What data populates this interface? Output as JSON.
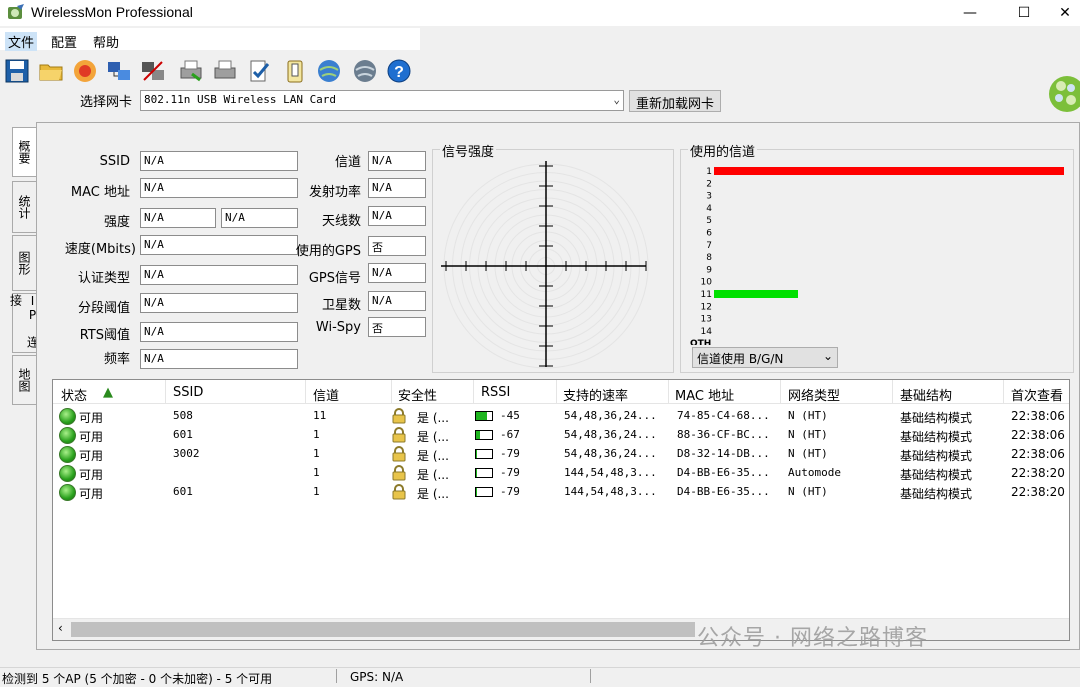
{
  "window": {
    "title": "WirelessMon Professional",
    "controls": {
      "minimize": "—",
      "maximize": "☐",
      "close": "✕"
    }
  },
  "menu": {
    "items": [
      "文件",
      "配置",
      "帮助"
    ]
  },
  "toolbar": {
    "icons": [
      "save-icon",
      "open-folder-icon",
      "record-icon",
      "network-adapter-icon",
      "network-adapter-off-icon",
      "print-icon",
      "print-preview-icon",
      "checklist-icon",
      "clipboard-icon",
      "globe-back-icon",
      "globe-forward-icon",
      "help-icon"
    ]
  },
  "nic": {
    "label": "选择网卡",
    "selected": "802.11n USB Wireless LAN Card",
    "reload_label": "重新加载网卡"
  },
  "tabs": [
    "概要",
    "统计",
    "图形",
    "IP 连接",
    "地图"
  ],
  "summary": {
    "left_fields": [
      {
        "label": "SSID",
        "value": "N/A"
      },
      {
        "label": "MAC 地址",
        "value": "N/A"
      },
      {
        "label": "强度",
        "value": "N/A",
        "value2": "N/A"
      },
      {
        "label": "速度(Mbits)",
        "value": "N/A"
      },
      {
        "label": "认证类型",
        "value": "N/A"
      },
      {
        "label": "分段阈值",
        "value": "N/A"
      },
      {
        "label": "RTS阈值",
        "value": "N/A"
      },
      {
        "label": "频率",
        "value": "N/A"
      }
    ],
    "right_fields": [
      {
        "label": "信道",
        "value": "N/A"
      },
      {
        "label": "发射功率",
        "value": "N/A"
      },
      {
        "label": "天线数",
        "value": "N/A"
      },
      {
        "label": "使用的GPS",
        "value": "否"
      },
      {
        "label": "GPS信号",
        "value": "N/A"
      },
      {
        "label": "卫星数",
        "value": "N/A"
      },
      {
        "label": "Wi-Spy",
        "value": "否"
      }
    ]
  },
  "signal_group": {
    "title": "信号强度"
  },
  "channel_group": {
    "title": "使用的信道",
    "channel_labels": [
      "1",
      "2",
      "3",
      "4",
      "5",
      "6",
      "7",
      "8",
      "9",
      "10",
      "11",
      "12",
      "13",
      "14",
      "OTH"
    ],
    "usage": [
      {
        "channel": "1",
        "fraction": 1.0,
        "color": "#ff0000"
      },
      {
        "channel": "11",
        "fraction": 0.24,
        "color": "#00e000"
      }
    ],
    "mode_select": "信道使用 B/G/N"
  },
  "ap_list": {
    "columns": [
      "状态",
      "SSID",
      "信道",
      "安全性",
      "RSSI",
      "支持的速率",
      "MAC 地址",
      "网络类型",
      "基础结构",
      "首次查看"
    ],
    "rows": [
      {
        "status": "可用",
        "ssid": "508",
        "channel": "11",
        "security": "是 (...",
        "signal": 0.7,
        "rssi": "-45",
        "rates": "54,48,36,24...",
        "mac": "74-85-C4-68...",
        "net_type": "N (HT)",
        "infra": "基础结构模式",
        "first_seen": "22:38:06"
      },
      {
        "status": "可用",
        "ssid": "601",
        "channel": "1",
        "security": "是 (...",
        "signal": 0.25,
        "rssi": "-67",
        "rates": "54,48,36,24...",
        "mac": "88-36-CF-BC...",
        "net_type": "N (HT)",
        "infra": "基础结构模式",
        "first_seen": "22:38:06"
      },
      {
        "status": "可用",
        "ssid": "3002",
        "channel": "1",
        "security": "是 (...",
        "signal": 0.05,
        "rssi": "-79",
        "rates": "54,48,36,24...",
        "mac": "D8-32-14-DB...",
        "net_type": "N (HT)",
        "infra": "基础结构模式",
        "first_seen": "22:38:06"
      },
      {
        "status": "可用",
        "ssid": "",
        "channel": "1",
        "security": "是 (...",
        "signal": 0.05,
        "rssi": "-79",
        "rates": "144,54,48,3...",
        "mac": "D4-BB-E6-35...",
        "net_type": "Automode",
        "infra": "基础结构模式",
        "first_seen": "22:38:20"
      },
      {
        "status": "可用",
        "ssid": "601",
        "channel": "1",
        "security": "是 (...",
        "signal": 0.05,
        "rssi": "-79",
        "rates": "144,54,48,3...",
        "mac": "D4-BB-E6-35...",
        "net_type": "N (HT)",
        "infra": "基础结构模式",
        "first_seen": "22:38:20"
      }
    ]
  },
  "statusbar": {
    "ap_summary": "检测到 5 个AP (5 个加密 - 0 个未加密) - 5 个可用",
    "gps": "GPS: N/A"
  },
  "watermark": "公众号 · 网络之路博客"
}
